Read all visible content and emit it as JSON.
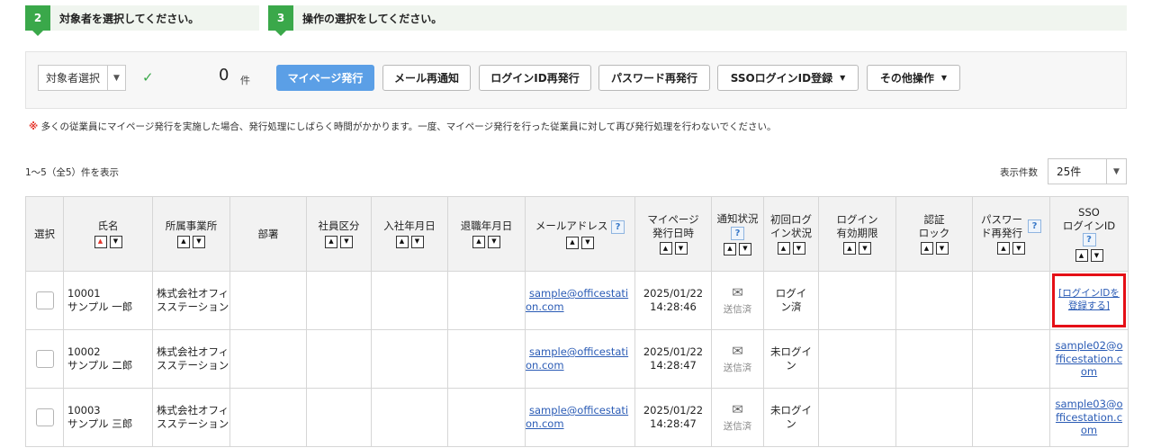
{
  "steps": [
    {
      "number": "2",
      "text": "対象者を選択してください。"
    },
    {
      "number": "3",
      "text": "操作の選択をしてください。"
    }
  ],
  "panel": {
    "target_select_label": "対象者選択",
    "count": "0",
    "count_unit": "件",
    "buttons": {
      "mypage_issue": "マイページ発行",
      "mail_resend": "メール再通知",
      "loginid_reissue": "ログインID再発行",
      "password_reissue": "パスワード再発行",
      "sso_register": "SSOログインID登録",
      "other_ops": "その他操作"
    }
  },
  "notice": {
    "mark": "※",
    "text": "多くの従業員にマイページ発行を実施した場合、発行処理にしばらく時間がかかります。一度、マイページ発行を行った従業員に対して再び発行処理を行わないでください。"
  },
  "list_info": {
    "range_text": "1～5（全5）件を表示",
    "perpage_label": "表示件数",
    "perpage_value": "25件"
  },
  "table": {
    "headers": {
      "select": "選択",
      "name": "氏名",
      "office": "所属事業所",
      "dept": "部署",
      "emp_type": "社員区分",
      "join_date": "入社年月日",
      "leave_date": "退職年月日",
      "email": "メールアドレス",
      "issued_at_1": "マイページ",
      "issued_at_2": "発行日時",
      "notify_status": "通知状況",
      "first_login_1": "初回ログ",
      "first_login_2": "イン状況",
      "login_expiry_1": "ログイン",
      "login_expiry_2": "有効期限",
      "auth_lock_1": "認証",
      "auth_lock_2": "ロック",
      "pw_reissue_1": "パスワー",
      "pw_reissue_2": "ド再発行",
      "sso_1": "SSO",
      "sso_2": "ログインID"
    },
    "help_glyph": "?",
    "rows": [
      {
        "id": "10001",
        "name": "サンプル 一郎",
        "office": "株式会社オフィスステーション",
        "email": "sample@officestation.com",
        "date": "2025/01/22",
        "time": "14:28:46",
        "notify": "送信済",
        "login": "ログイン済",
        "sso": "[ログインIDを登録する]"
      },
      {
        "id": "10002",
        "name": "サンプル 二郎",
        "office": "株式会社オフィスステーション",
        "email": "sample@officestation.com",
        "date": "2025/01/22",
        "time": "14:28:47",
        "notify": "送信済",
        "login": "未ログイン",
        "sso": "sample02@officestation.com"
      },
      {
        "id": "10003",
        "name": "サンプル 三郎",
        "office": "株式会社オフィスステーション",
        "email": "sample@officestation.com",
        "date": "2025/01/22",
        "time": "14:28:47",
        "notify": "送信済",
        "login": "未ログイン",
        "sso": "sample03@officestation.com"
      }
    ]
  }
}
